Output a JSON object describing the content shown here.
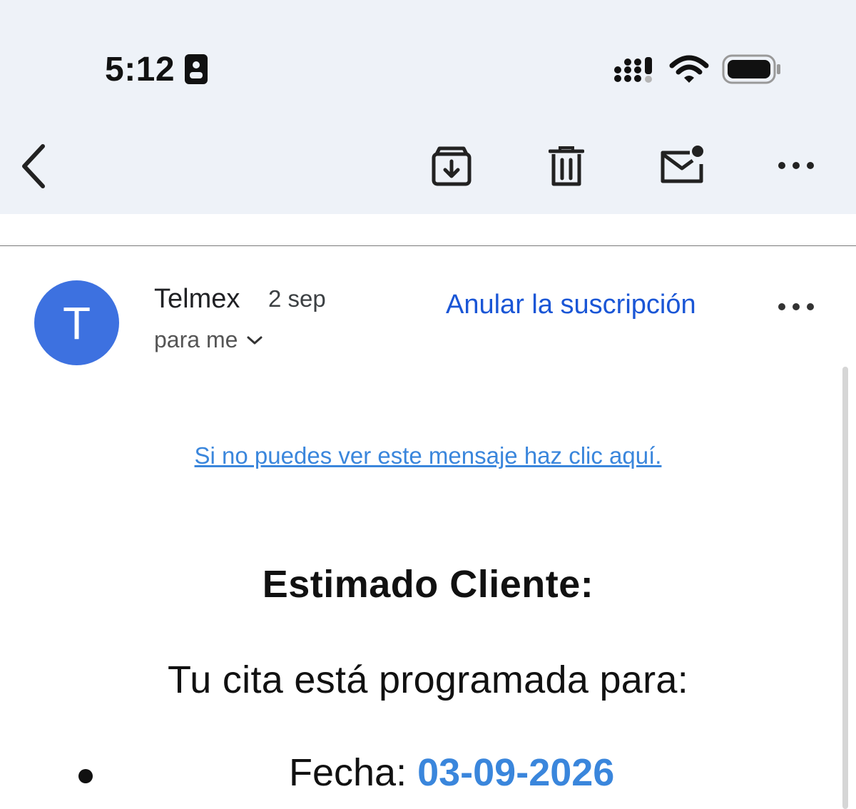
{
  "status_bar": {
    "time": "5:12"
  },
  "icons": {
    "id": "id-card-icon",
    "signal": "cellular-signal-icon",
    "wifi": "wifi-icon",
    "battery": "battery-icon",
    "back": "chevron-left-icon",
    "archive": "archive-icon",
    "delete": "trash-icon",
    "mark_unread": "mail-unread-icon",
    "more": "more-horizontal-icon"
  },
  "message": {
    "avatar_letter": "T",
    "sender": "Telmex",
    "date": "2 sep",
    "recipient": "para me",
    "unsubscribe": "Anular la suscripción"
  },
  "body": {
    "view_link": "Si no puedes ver este mensaje haz clic aquí.",
    "greeting": "Estimado Cliente:",
    "intro": "Tu cita está programada para:",
    "date_label": "Fecha: ",
    "date_value": "03-09-2026"
  },
  "colors": {
    "toolbar_bg": "#eef2f8",
    "avatar_bg": "#3d71e0",
    "link_blue": "#1a56d6",
    "body_link": "#3a86dc"
  }
}
